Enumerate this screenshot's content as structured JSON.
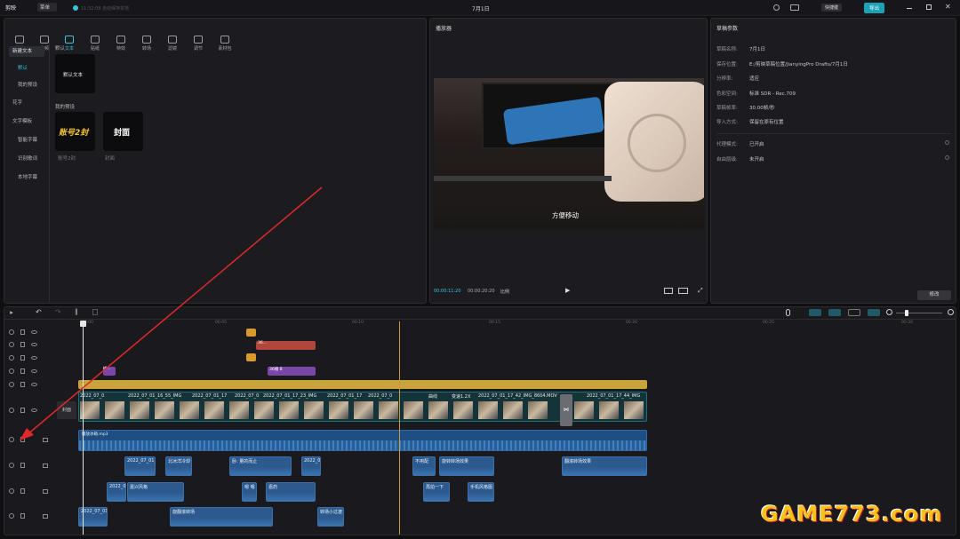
{
  "app": {
    "logo": "剪映",
    "menu": "菜单",
    "autosave": "11:32:08 自动保存本地",
    "project_title": "7月1日",
    "shortcut_btn": "快捷键",
    "export_btn": "导出"
  },
  "toolbar": {
    "items": [
      "媒体",
      "音频",
      "文本",
      "贴纸",
      "特效",
      "转场",
      "滤镜",
      "调节",
      "素材包"
    ],
    "active": "文本"
  },
  "sidebar": {
    "items": [
      "新建文本",
      "默认",
      "我的预设",
      "花字",
      "文字模板",
      "智能字幕",
      "识别歌词",
      "本地字幕"
    ]
  },
  "text_panel": {
    "section_default": "默认",
    "default_card": "默认文本",
    "section_presets": "我的预设",
    "preset1": "账号2封",
    "preset1_label": "账号2封",
    "preset2": "封面",
    "preset2_label": "封面"
  },
  "player": {
    "title": "播放器",
    "subtitle": "方便移动",
    "time_current": "00:00:11:20",
    "time_total": "00:00:20:20",
    "ratio": "比例"
  },
  "draft": {
    "title": "草稿参数",
    "rows": [
      {
        "label": "草稿名称:",
        "value": "7月1日"
      },
      {
        "label": "保存位置:",
        "value": "E:/剪映草稿位置/JianyingPro Drafts/7月1日"
      },
      {
        "label": "分辨率:",
        "value": "适应"
      },
      {
        "label": "色彩空间:",
        "value": "标准 SDR - Rec.709"
      },
      {
        "label": "草稿帧率:",
        "value": "30.00帧/秒"
      },
      {
        "label": "导入方式:",
        "value": "保留在原有位置"
      },
      {
        "label": "代理模式:",
        "value": "已开启"
      },
      {
        "label": "自由层级:",
        "value": "未开启"
      }
    ],
    "edit_btn": "修改"
  },
  "timeline": {
    "ruler": [
      "00:00",
      "00:05",
      "00:10",
      "00:15",
      "00:20",
      "00:25",
      "00:30"
    ],
    "cover_label": "封面",
    "text_clip1": "I6…",
    "text_clip2": "36…",
    "text_clip3": "…",
    "effect_clip": "36播 B",
    "gold_clip": "…",
    "main_clips": [
      "2022_07_0",
      "2022_07_01_16_55_IMG",
      "2022_07_01_17",
      "2022_07_0",
      "2022_07_01_17_23_IMG",
      "2022_07_01_17",
      "2022_07_0",
      "曲线",
      "变速1.2X",
      "2022_07_01_17_42_IMG_8604.MOV",
      "2022_07_01_17_44_IMG"
    ],
    "music": "播放冰箱.mp3",
    "audio_row1": [
      "2022_07_01_1",
      "北冰洋冷却",
      "卧: 量的而止",
      "2022_07",
      "不用配",
      "旋转转场效果",
      "翻滚转场效果"
    ],
    "audio_row2": [
      "2022_0",
      "嘉兴风格",
      "嗯 嗯",
      "嘉药",
      "再拍一下",
      "手机风格图"
    ],
    "audio_row3": [
      "2022_07_01",
      "旋翻滚转场",
      "转场小过渡"
    ]
  },
  "watermark": "GAME773.com"
}
